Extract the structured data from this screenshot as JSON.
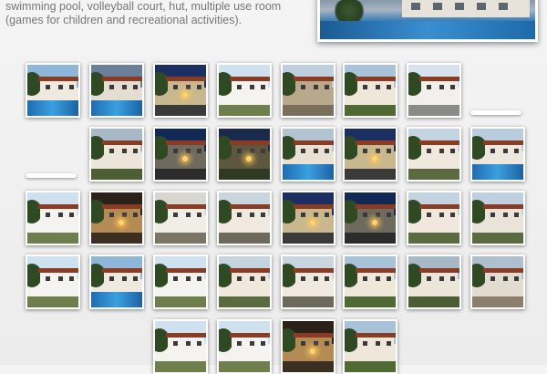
{
  "intro": {
    "text": "swimming pool, volleyball court, hut, multiple use room (games for children and recreational activities)."
  },
  "hero": {
    "icon": "pool-photo"
  },
  "gallery": {
    "thumbnails": [
      {
        "scene": "pool-day"
      },
      {
        "scene": "pool-dusk"
      },
      {
        "scene": "night-houses"
      },
      {
        "scene": "white-house"
      },
      {
        "scene": "stone-house"
      },
      {
        "scene": "garden-day"
      },
      {
        "scene": "white-house-fence"
      },
      {
        "scene": "house-trees"
      },
      {
        "scene": "night-street"
      },
      {
        "scene": "night-garden"
      },
      {
        "scene": "pool-umbrella"
      },
      {
        "scene": "night-houses"
      },
      {
        "scene": "balconies"
      },
      {
        "scene": "pool-chairs"
      },
      {
        "scene": "white-house"
      },
      {
        "scene": "night-porch"
      },
      {
        "scene": "porch-columns"
      },
      {
        "scene": "red-door"
      },
      {
        "scene": "night-houses"
      },
      {
        "scene": "night-street"
      },
      {
        "scene": "balconies"
      },
      {
        "scene": "garden-chairs"
      },
      {
        "scene": "white-house"
      },
      {
        "scene": "pool-day"
      },
      {
        "scene": "white-house"
      },
      {
        "scene": "balconies"
      },
      {
        "scene": "red-door"
      },
      {
        "scene": "garden-day"
      },
      {
        "scene": "house-trees"
      },
      {
        "scene": "courtyard"
      },
      {
        "scene": "white-house"
      },
      {
        "scene": "white-house"
      },
      {
        "scene": "night-porch"
      },
      {
        "scene": "garden-day"
      }
    ]
  }
}
